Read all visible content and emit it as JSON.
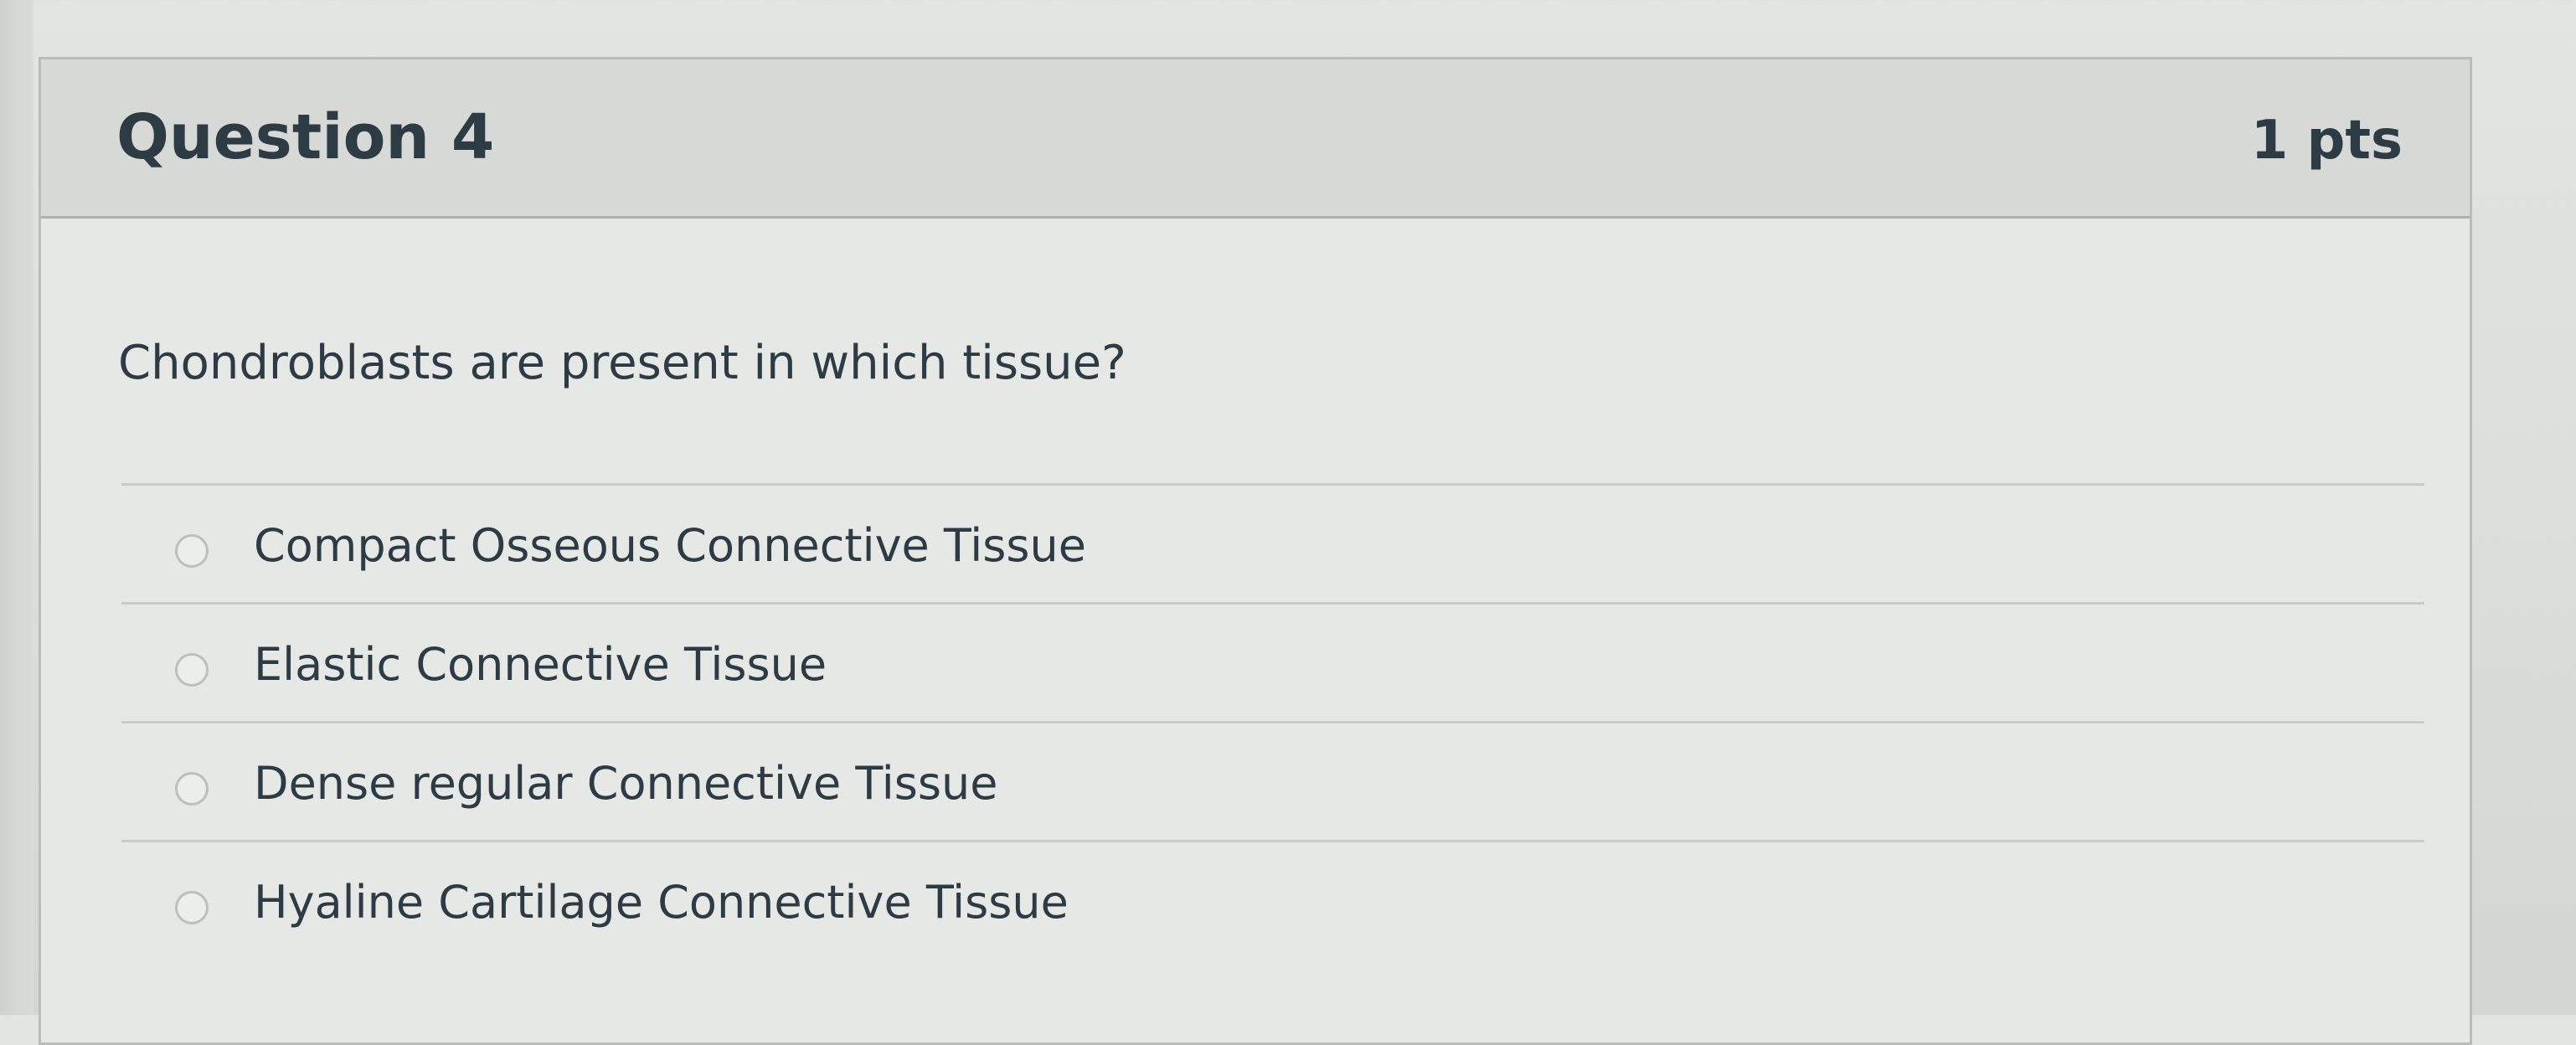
{
  "question": {
    "title": "Question 4",
    "points": "1 pts",
    "text": "Chondroblasts are present in which tissue?",
    "answers": [
      {
        "label": "Compact Osseous Connective Tissue",
        "selected": false
      },
      {
        "label": "Elastic Connective Tissue",
        "selected": false
      },
      {
        "label": "Dense regular Connective Tissue",
        "selected": false
      },
      {
        "label": "Hyaline Cartilage Connective Tissue",
        "selected": false
      }
    ]
  },
  "colors": {
    "text": "#2d3b45",
    "header_background": "#d6d9d6",
    "card_border": "#b9bdb9"
  }
}
